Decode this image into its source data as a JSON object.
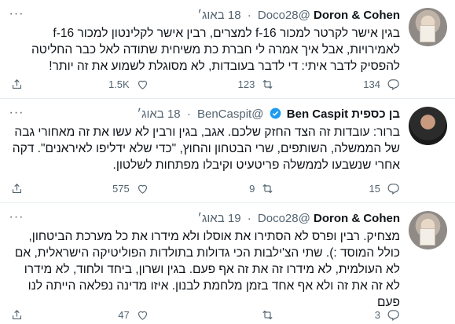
{
  "tweets": [
    {
      "name": "Doron & Cohen",
      "handle": "@Doco28",
      "date": "18 באוג׳",
      "verified": false,
      "text": "בגין אישר לקרטר למכור f-16 למצרים, רבין אישר לקלינטון למכור f-16 לאמירויות, אבל איך אמרה לי חברת כת משיחית שתודה לאל כבר החליטה להפסיק לדבר איתי: די לדבר בעובדות, לא מסוגלת לשמוע את זה יותר!",
      "replies": "134",
      "retweets": "123",
      "likes": "1.5K"
    },
    {
      "name": "בן כספית Ben Caspit",
      "handle": "@BenCaspit",
      "date": "18 באוג׳",
      "verified": true,
      "text": "ברור: עובדות זה הצד החזק שלכם. אגב, בגין ורבין לא עשו את זה מאחורי גבה של הממשלה, השותפים, שרי הבטחון והחוץ, \"כדי שלא ידליפו לאיראנים\". דקה אחרי שנשבעו לממשלה פריטעיט וקיבלו מפתחות לשלטון.",
      "replies": "15",
      "retweets": "9",
      "likes": "575"
    },
    {
      "name": "Doron & Cohen",
      "handle": "@Doco28",
      "date": "19 באוג׳",
      "verified": false,
      "text": "מצחיק. רבין ופרס לא הסתירו את אוסלו ולא מידרו את כל מערכת הביטחון, כולל המוסד :). שתי הצ'ילבות הכי גדולות בתולדות הפוליטיקה הישראלית, אם לא העולמית, לא מידרו זה את זה אף פעם. בגין ושרון, ביחד ולחוד, לא מידרו לא זה את זה ולא אף אחד בזמן מלחמת לבנון. איזו מדינה נפלאה הייתה לנו פעם",
      "replies": "3",
      "retweets": "",
      "likes": "47"
    }
  ],
  "icons": {
    "reply": "reply-icon",
    "retweet": "retweet-icon",
    "like": "like-icon",
    "share": "share-icon",
    "more": "more-icon",
    "verified": "verified-badge-icon"
  },
  "colors": {
    "text": "#0f1419",
    "secondary": "#536471",
    "verified": "#1d9bf0",
    "divider": "#e6ecf0"
  }
}
